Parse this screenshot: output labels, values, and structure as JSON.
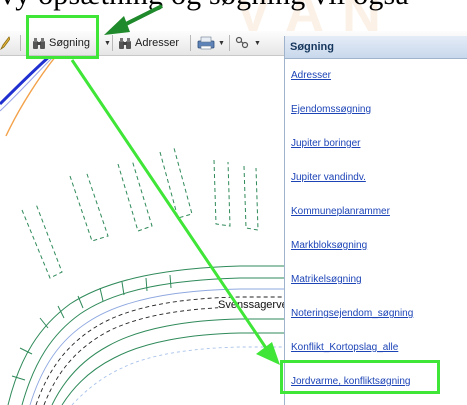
{
  "caption": {
    "text": "vy opsætning og søgning vil også"
  },
  "toolbar": {
    "soegning_label": "Søgning",
    "adresser_label": "Adresser"
  },
  "map": {
    "street_label": "Svenssagervej"
  },
  "panel": {
    "title": "Søgning",
    "items": [
      {
        "label": "Adresser"
      },
      {
        "label": "Ejendomssøgning"
      },
      {
        "label": "Jupiter boringer"
      },
      {
        "label": "Jupiter vandindv."
      },
      {
        "label": "Kommuneplanrammer"
      },
      {
        "label": "Markbloksøgning"
      },
      {
        "label": "Matrikelsøgning"
      },
      {
        "label": "Noteringsejendom_søgning"
      },
      {
        "label": "Konflikt_Kortopslag_alle"
      },
      {
        "label": "Jordvarme, konfliktsøgning"
      }
    ]
  },
  "colors": {
    "highlight": "#3fe637",
    "arrow_dark": "#1f8a2b",
    "link": "#1d44b7",
    "panel_header": "#c9d8ec"
  }
}
